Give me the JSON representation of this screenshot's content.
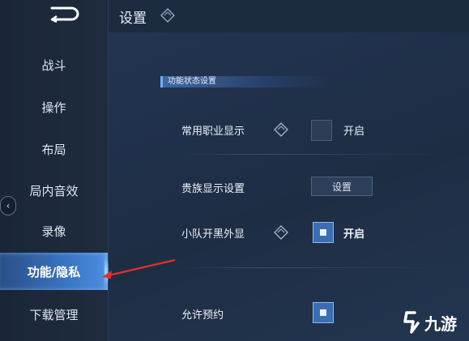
{
  "header": {
    "title": "设置"
  },
  "sidebar": {
    "items": [
      {
        "label": "战斗"
      },
      {
        "label": "操作"
      },
      {
        "label": "布局"
      },
      {
        "label": "局内音效"
      },
      {
        "label": "录像"
      },
      {
        "label": "功能/隐私",
        "active": true
      },
      {
        "label": "下载管理"
      }
    ],
    "collapse_glyph": "‹"
  },
  "section": {
    "title": "功能状态设置"
  },
  "rows": {
    "career": {
      "label": "常用职业显示",
      "value": "开启",
      "checked": false
    },
    "noble": {
      "label": "贵族显示设置",
      "button": "设置"
    },
    "squad": {
      "label": "小队开黑外显",
      "value": "开启",
      "checked": true
    },
    "reserve": {
      "label": "允许预约",
      "checked": true
    }
  },
  "watermark": {
    "text": "九游"
  },
  "colors": {
    "accent": "#3a73c2",
    "annotation": "#e0302a"
  }
}
